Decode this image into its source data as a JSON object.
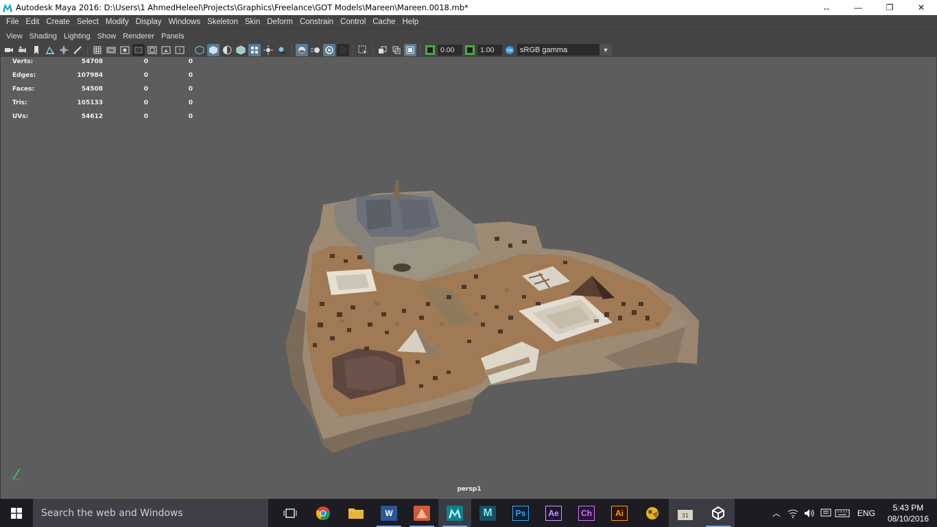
{
  "window": {
    "title": "Autodesk Maya 2016: D:\\Users\\1 AhmedHeleel\\Projects\\Graphics\\Freelance\\GOT Models\\Mareen\\Mareen.0018.mb*",
    "resize_glyph": "↔",
    "minimize_glyph": "—",
    "restore_glyph": "❐",
    "close_glyph": "✕"
  },
  "menubar": [
    "File",
    "Edit",
    "Create",
    "Select",
    "Modify",
    "Display",
    "Windows",
    "Skeleton",
    "Skin",
    "Deform",
    "Constrain",
    "Control",
    "Cache",
    "Help"
  ],
  "panel_menu": [
    "View",
    "Shading",
    "Lighting",
    "Show",
    "Renderer",
    "Panels"
  ],
  "toolbar": {
    "exposure_value": "0.00",
    "gamma_value": "1.00",
    "color_space": "sRGB gamma"
  },
  "hud": {
    "rows": [
      {
        "label": "Verts:",
        "v1": "54708",
        "v2": "0",
        "v3": "0"
      },
      {
        "label": "Edges:",
        "v1": "107984",
        "v2": "0",
        "v3": "0"
      },
      {
        "label": "Faces:",
        "v1": "54508",
        "v2": "0",
        "v3": "0"
      },
      {
        "label": "Tris:",
        "v1": "105133",
        "v2": "0",
        "v3": "0"
      },
      {
        "label": "UVs:",
        "v1": "54612",
        "v2": "0",
        "v3": "0"
      }
    ]
  },
  "viewport": {
    "camera_name": "persp1"
  },
  "taskbar": {
    "search_placeholder": "Search the web and Windows",
    "apps": [
      {
        "name": "task-view",
        "icon": "task-view-icon"
      },
      {
        "name": "chrome",
        "icon": "chrome-icon"
      },
      {
        "name": "file-explorer",
        "icon": "folder-icon"
      },
      {
        "name": "word",
        "icon": "word-icon",
        "label": "W"
      },
      {
        "name": "mudbox",
        "icon": "mudbox-icon"
      },
      {
        "name": "maya",
        "icon": "maya-icon"
      },
      {
        "name": "motionbuilder",
        "icon": "motionbuilder-icon",
        "label": "M"
      },
      {
        "name": "photoshop",
        "icon": "photoshop-icon",
        "label": "Ps"
      },
      {
        "name": "after-effects",
        "icon": "after-effects-icon",
        "label": "Ae"
      },
      {
        "name": "character-animator",
        "icon": "character-animator-icon",
        "label": "Ch"
      },
      {
        "name": "illustrator",
        "icon": "illustrator-icon",
        "label": "Ai"
      },
      {
        "name": "game",
        "icon": "game-icon"
      },
      {
        "name": "video-editor",
        "icon": "video-editor-icon"
      },
      {
        "name": "unity",
        "icon": "unity-icon"
      }
    ],
    "language": "ENG",
    "time": "5:43 PM",
    "date": "08/10/2016"
  },
  "colors": {
    "viewport_bg": "#5d5d5d",
    "panel_bg": "#444444",
    "taskbar_bg": "#1c1c22",
    "active_tool": "#5a7a92"
  }
}
